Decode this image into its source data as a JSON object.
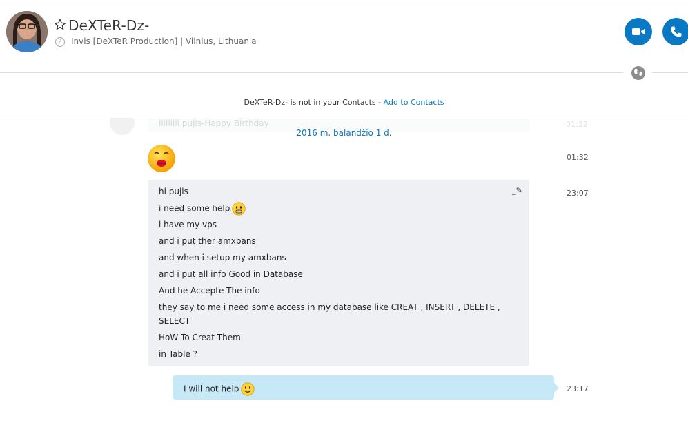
{
  "header": {
    "contact_name": "DeXTeR-Dz-",
    "status": "Invis [DeXTeR Production]  |  Vilnius, Lithuania",
    "video_call_label": "Video call",
    "audio_call_label": "Call"
  },
  "notice": {
    "text": "DeXTeR-Dz- is not in your Contacts - ",
    "link": "Add to Contacts"
  },
  "faded_message": {
    "text": "lllllllll pujis-Happy Birthday",
    "time": "01:32"
  },
  "date_separator": "2016 m. balandžio 1 d.",
  "messages": [
    {
      "type": "emoticon",
      "icon": "kiss-emoticon",
      "time": "01:32"
    },
    {
      "type": "incoming",
      "time": "23:07",
      "lines": [
        "hi pujis",
        "i need some help",
        "i have my vps",
        "and i put ther amxbans",
        "and when i setup my amxbans",
        "and i put all info Good in Database",
        "And he Accepte The info",
        "they say to me i need some access in my database like CREAT , INSERT , DELETE ,",
        "SELECT",
        "HoW To Creat Them",
        "in Table ?"
      ]
    },
    {
      "type": "outgoing",
      "time": "23:17",
      "text": "I will not help"
    }
  ],
  "colors": {
    "accent": "#0a78c2",
    "incoming_bubble": "#eef0f3",
    "outgoing_bubble": "#c7e8f7"
  }
}
